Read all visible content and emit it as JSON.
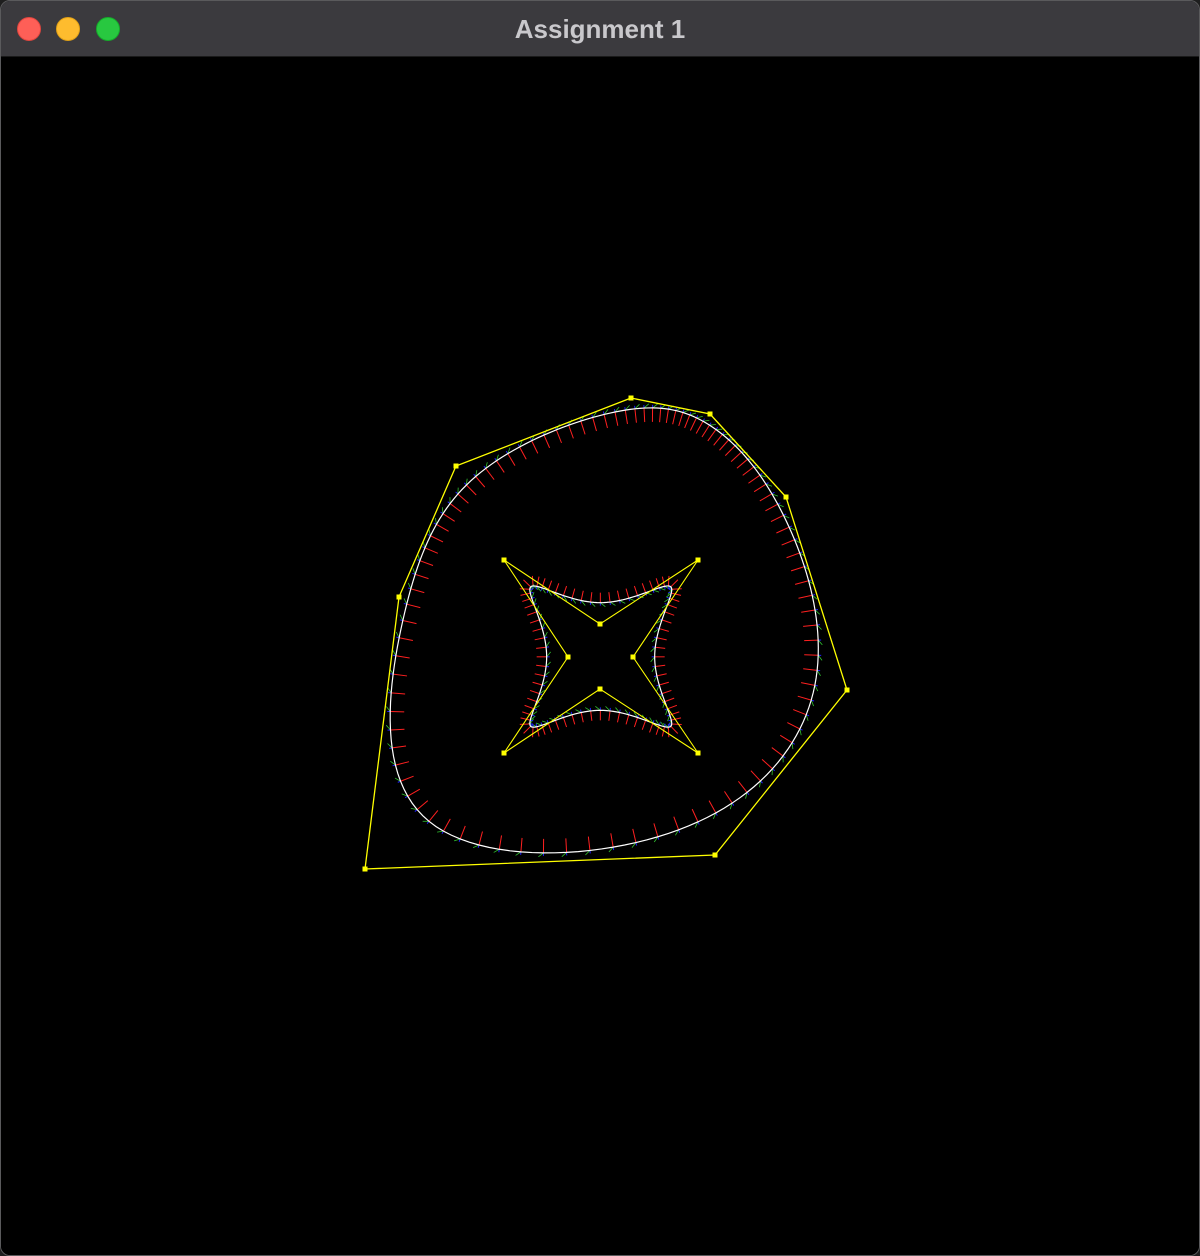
{
  "window": {
    "title": "Assignment 1"
  },
  "colors": {
    "background": "#000000",
    "control_polygon": "#ffff00",
    "control_point": "#ffff00",
    "curve": "#ffffff",
    "normal": "#ff2020",
    "tangent": "#30c030",
    "binormal": "#2020ff"
  },
  "icons": [
    "close-icon",
    "minimize-icon",
    "zoom-icon"
  ]
}
